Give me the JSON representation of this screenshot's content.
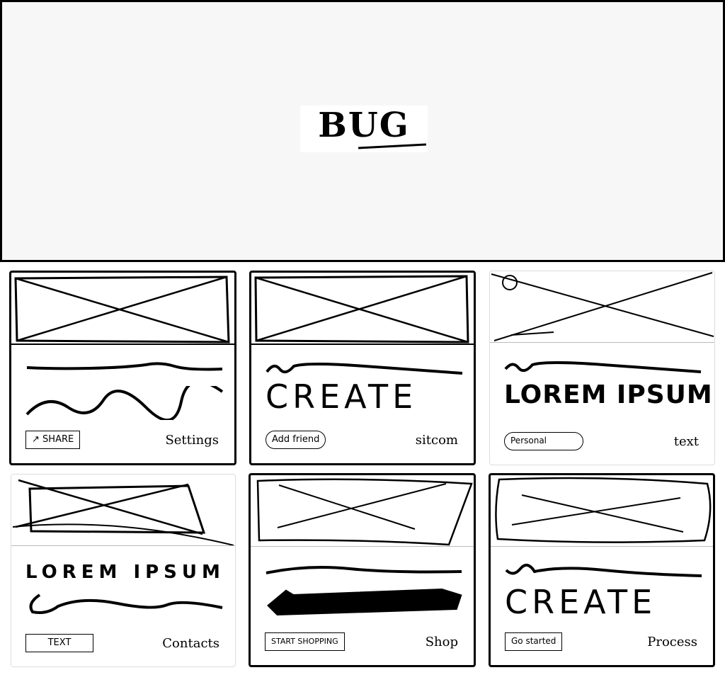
{
  "hero": {
    "title": "BUG"
  },
  "cards": [
    {
      "button": "SHARE",
      "link": "Settings"
    },
    {
      "heading": "CREATE",
      "button": "Add friend",
      "link": "sitcom"
    },
    {
      "heading": "LOREM IPSUM",
      "button": "Personal",
      "link": "text"
    },
    {
      "heading": "LOREM IPSUM",
      "button": "TEXT",
      "link": "Contacts"
    },
    {
      "button": "START SHOPPING",
      "link": "Shop"
    },
    {
      "heading": "CREATE",
      "button": "Go started",
      "link": "Process"
    }
  ],
  "icons": {
    "image_placeholder": "image-placeholder-icon",
    "share": "share-icon"
  },
  "colors": {
    "ink": "#000000",
    "hero_bg": "#f7f7f7",
    "card_bg": "#ffffff"
  }
}
